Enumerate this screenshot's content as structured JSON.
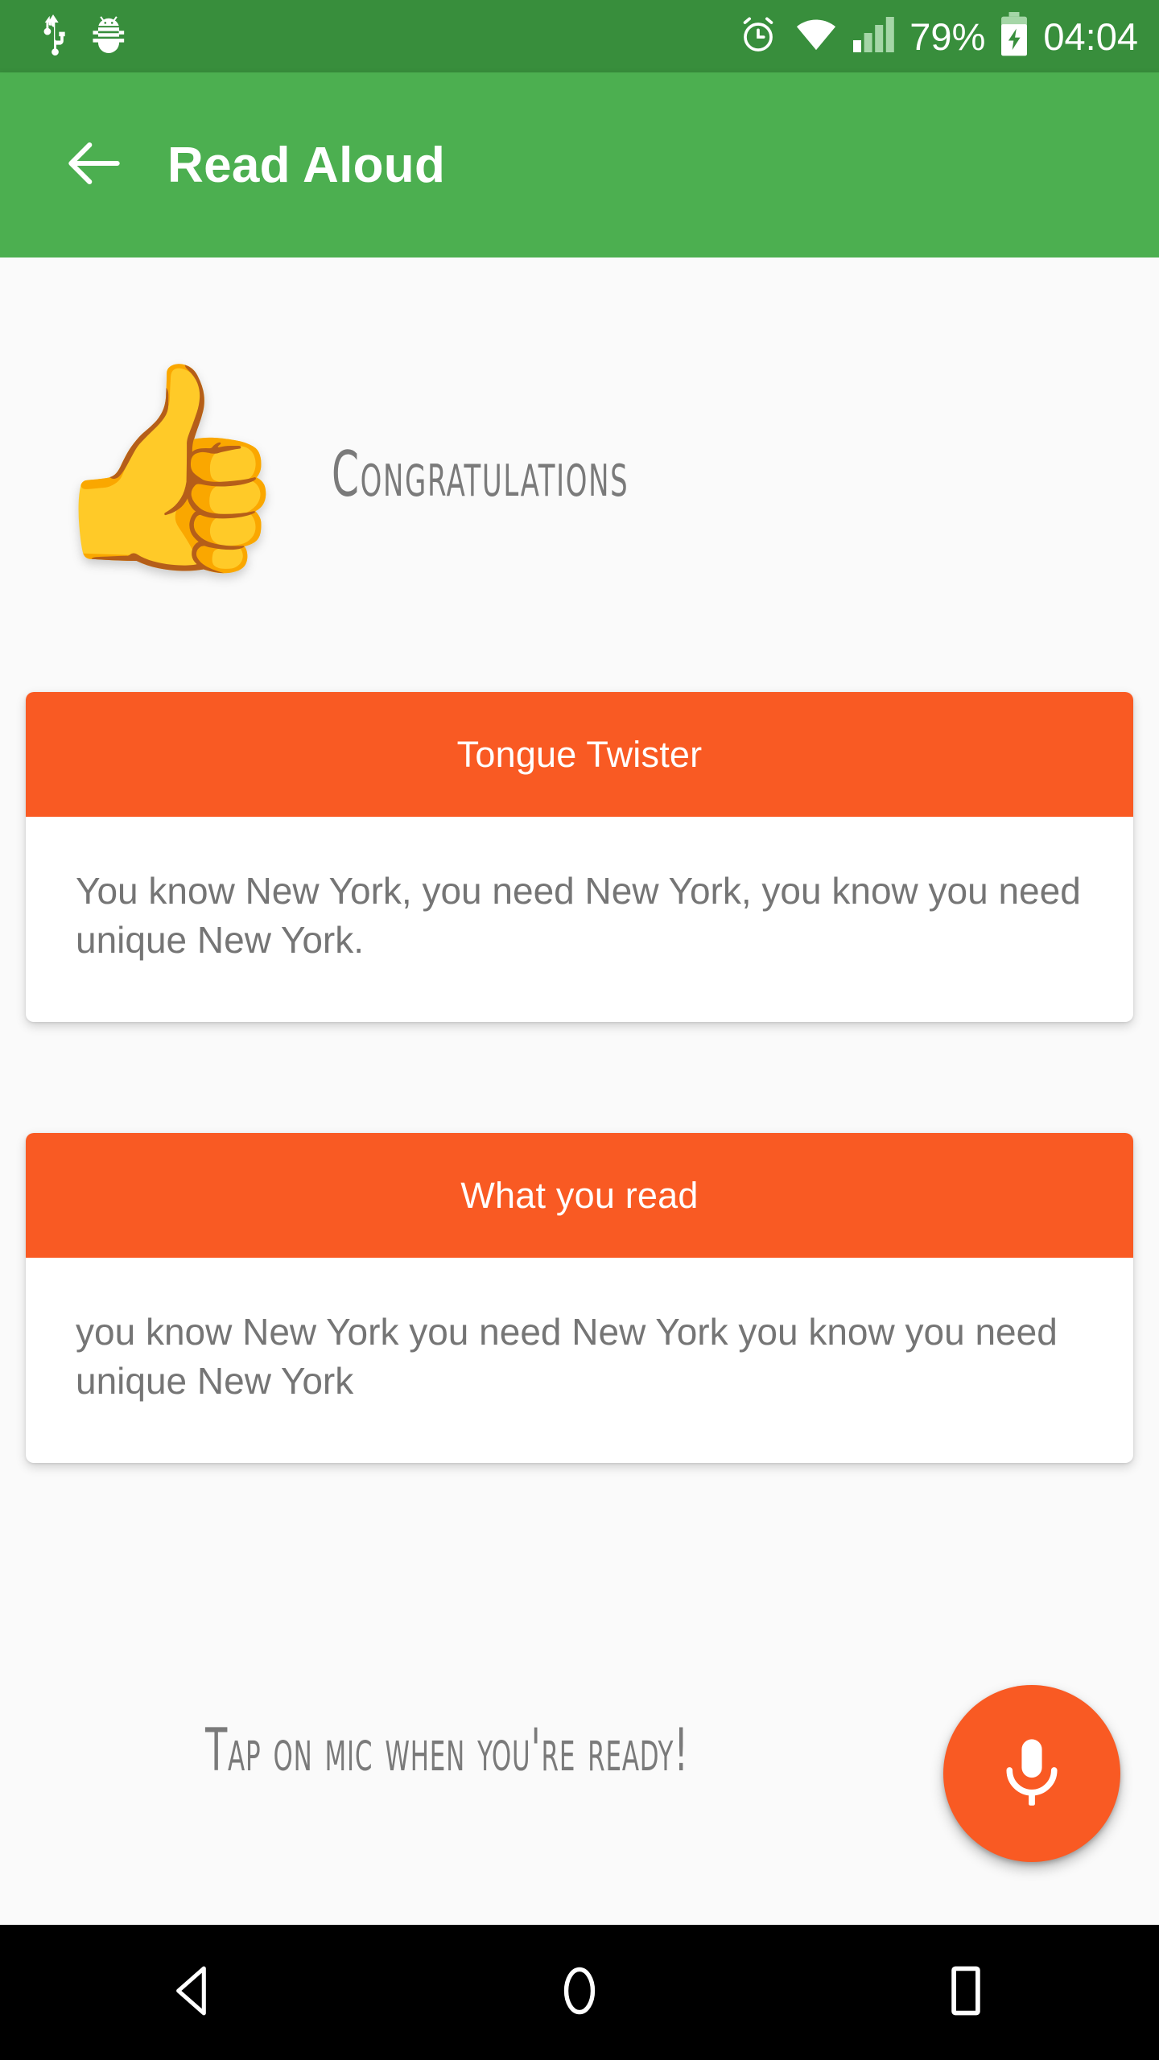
{
  "statusbar": {
    "left_icons": [
      {
        "name": "usb-icon",
        "label": "USB"
      },
      {
        "name": "android-debug-bug-icon",
        "label": "Debug"
      }
    ],
    "right_icons": [
      {
        "name": "alarm-clock-icon",
        "label": "Alarm"
      },
      {
        "name": "wifi-icon",
        "label": "Wi-Fi"
      },
      {
        "name": "cellular-signal-icon",
        "label": "Signal"
      }
    ],
    "battery_percent": "79%",
    "battery_icon": "battery-charging-icon",
    "time": "04:04",
    "background_color": "#388E3C"
  },
  "appbar": {
    "back_icon": "arrow-back-icon",
    "title": "Read Aloud",
    "background_color": "#4CAF50",
    "text_color": "#FFFFFF"
  },
  "result": {
    "emoji": "👍",
    "emoji_name": "thumbs-up-emoji",
    "headline": "Congratulations"
  },
  "cards": [
    {
      "id": "tongue-twister",
      "header": "Tongue Twister",
      "body": "You know New York, you need New York, you know you need unique New York.",
      "header_color": "#F95A23",
      "header_text_color": "#FFFFFF",
      "body_text_color": "#757575"
    },
    {
      "id": "what-you-read",
      "header": "What you read",
      "body": "you know New York you need New York you know you need unique New York",
      "header_color": "#F95A23",
      "header_text_color": "#FFFFFF",
      "body_text_color": "#757575"
    }
  ],
  "footer": {
    "hint": "Tap on mic when you're ready!",
    "mic_icon": "microphone-icon",
    "fab_color": "#F95A23"
  },
  "navbar": {
    "back": "navigation-back-icon",
    "home": "navigation-home-icon",
    "recents": "navigation-recents-icon",
    "background_color": "#000000"
  },
  "theme": {
    "page_background": "#FAFAFA",
    "accent_green": "#4CAF50",
    "accent_orange": "#F95A23",
    "muted_text": "#757575"
  }
}
